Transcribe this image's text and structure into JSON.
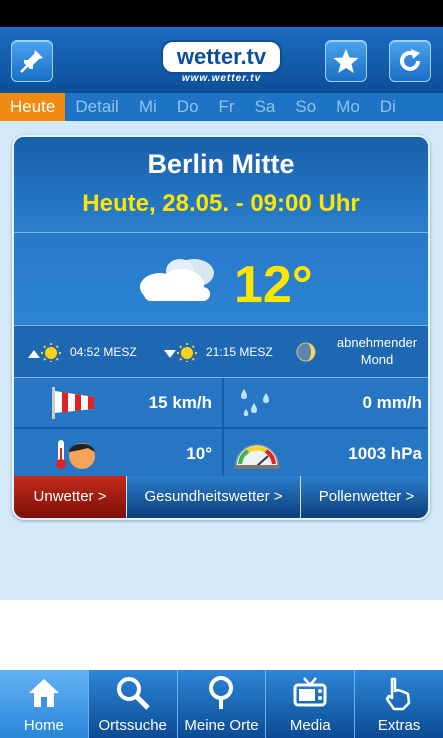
{
  "header": {
    "logo_text": "wetter.tv",
    "logo_url": "www.wetter.tv"
  },
  "tabs": [
    {
      "label": "Heute",
      "active": true
    },
    {
      "label": "Detail"
    },
    {
      "label": "Mi"
    },
    {
      "label": "Do"
    },
    {
      "label": "Fr"
    },
    {
      "label": "Sa"
    },
    {
      "label": "So"
    },
    {
      "label": "Mo"
    },
    {
      "label": "Di"
    }
  ],
  "weather": {
    "city": "Berlin Mitte",
    "datetime": "Heute, 28.05. - 09:00 Uhr",
    "temperature": "12°",
    "sunrise": "04:52 MESZ",
    "sunset": "21:15 MESZ",
    "moon_phase": "abnehmender Mond",
    "wind": "15 km/h",
    "precipitation": "0 mm/h",
    "felt_temperature": "10°",
    "pressure": "1003 hPa"
  },
  "links": {
    "unwetter": "Unwetter >",
    "gesundheit": "Gesundheitswetter >",
    "pollen": "Pollenwetter >"
  },
  "nav": {
    "home": "Home",
    "ortssuche": "Ortssuche",
    "meine_orte": "Meine Orte",
    "media": "Media",
    "extras": "Extras"
  },
  "colors": {
    "accent_tab": "#f08a11",
    "temperature": "#ffe600",
    "alert": "#c32b1a"
  }
}
